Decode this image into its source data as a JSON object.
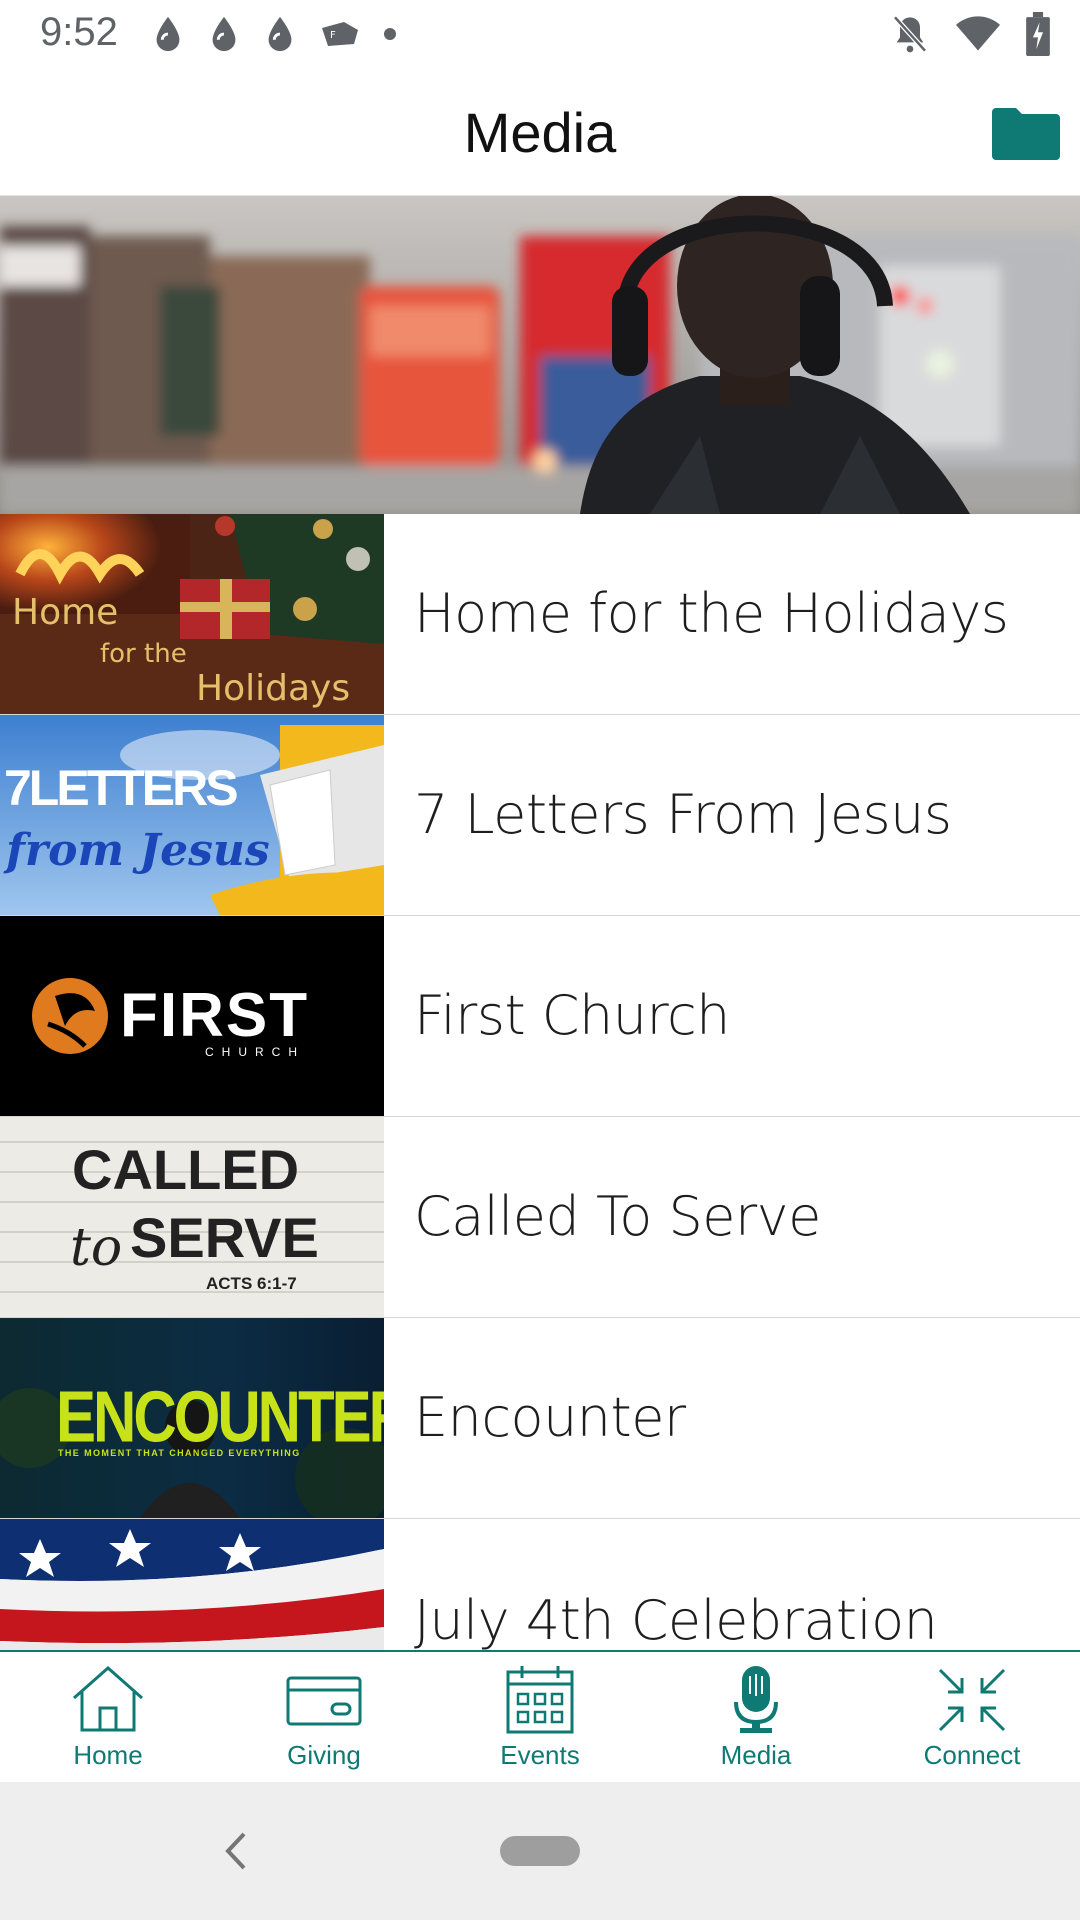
{
  "status_bar": {
    "time": "9:52",
    "left_icons": [
      "drop-icon",
      "drop-icon",
      "drop-icon",
      "app-logo-icon",
      "dot-icon"
    ],
    "right_icons": [
      "notifications-off-icon",
      "wifi-icon",
      "battery-charging-icon"
    ]
  },
  "app_bar": {
    "title": "Media",
    "action_icon": "folder-icon"
  },
  "hero": {
    "description_icon": "headphones-photo"
  },
  "media_list": [
    {
      "title": "Home for the Holidays",
      "thumb": {
        "line1": "Home",
        "line2": "for the",
        "line3": "Holidays"
      }
    },
    {
      "title": "7 Letters From Jesus",
      "thumb": {
        "line1": "7LETTERS",
        "line2": "from Jesus"
      }
    },
    {
      "title": "First Church",
      "thumb": {
        "line1": "FIRST",
        "line2": "CHURCH"
      }
    },
    {
      "title": "Called To Serve",
      "thumb": {
        "line1": "CALLED",
        "line2": "to",
        "line3": "SERVE",
        "line4": "ACTS 6:1-7"
      }
    },
    {
      "title": "Encounter",
      "thumb": {
        "line1": "ENCOUNTER",
        "line2": "THE MOMENT THAT CHANGED EVERYTHING"
      }
    },
    {
      "title": "July 4th Celebration",
      "thumb": {}
    }
  ],
  "bottom_nav": [
    {
      "label": "Home",
      "icon": "home-icon"
    },
    {
      "label": "Giving",
      "icon": "credit-card-icon"
    },
    {
      "label": "Events",
      "icon": "calendar-icon"
    },
    {
      "label": "Media",
      "icon": "microphone-icon",
      "active": true
    },
    {
      "label": "Connect",
      "icon": "connect-arrows-icon"
    }
  ],
  "colors": {
    "accent": "#0f7a73",
    "text": "#1e1e1e",
    "divider": "#d6d6d6"
  }
}
